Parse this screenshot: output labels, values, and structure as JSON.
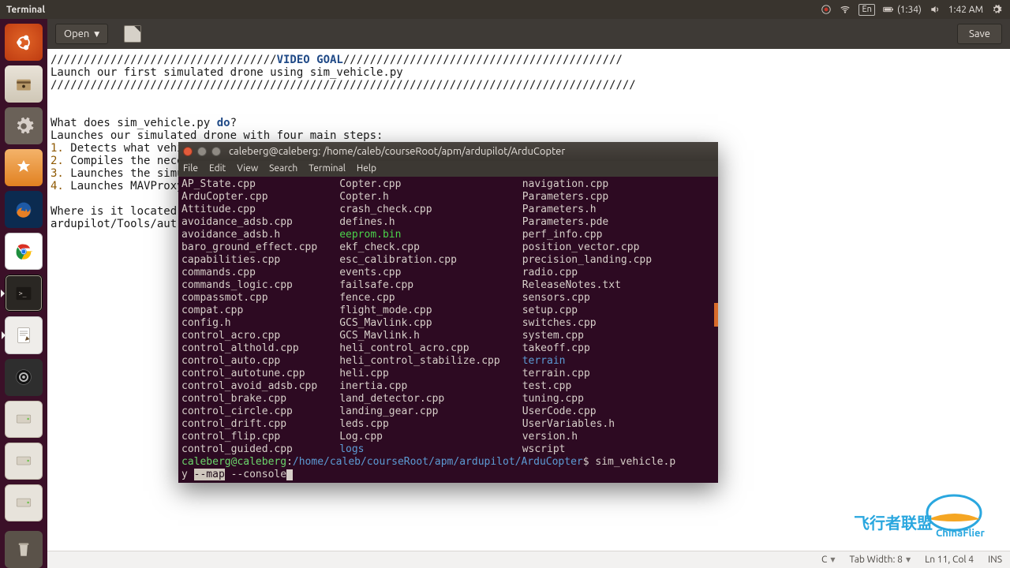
{
  "top_panel": {
    "app_title": "Terminal",
    "language": "En",
    "battery_text": "(1:34)",
    "clock": "1:42 AM"
  },
  "gedit": {
    "open_label": "Open",
    "save_label": "Save",
    "comment_border_a": "//////////////////////////////////",
    "heading": "VIDEO GOAL",
    "comment_border_b": "//////////////////////////////////////////",
    "intro_line": "Launch our first simulated drone using sim_vehicle.py",
    "comment_border_full": "////////////////////////////////////////////////////////////////////////////////////////",
    "question": "What does sim_vehicle.py",
    "question_kw": "do",
    "question_tail": "?",
    "desc": "Launches our simulated drone with four main steps:",
    "steps": [
      "Detects what vehi",
      "Compiles the nece",
      "Launches the simu",
      "Launches MAVProxy"
    ],
    "where_q": "Where is it located",
    "where_a": "ardupilot/Tools/aut"
  },
  "status_bar": {
    "lang": "C",
    "tab_width": "Tab Width: 8",
    "cursor": "Ln 11, Col 4",
    "insert": "INS"
  },
  "terminal": {
    "title": "caleberg@caleberg: /home/caleb/courseRoot/apm/ardupilot/ArduCopter",
    "menu": [
      "File",
      "Edit",
      "View",
      "Search",
      "Terminal",
      "Help"
    ],
    "files_col1": [
      "AP_State.cpp",
      "ArduCopter.cpp",
      "Attitude.cpp",
      "avoidance_adsb.cpp",
      "avoidance_adsb.h",
      "baro_ground_effect.cpp",
      "capabilities.cpp",
      "commands.cpp",
      "commands_logic.cpp",
      "compassmot.cpp",
      "compat.cpp",
      "config.h",
      "control_acro.cpp",
      "control_althold.cpp",
      "control_auto.cpp",
      "control_autotune.cpp",
      "control_avoid_adsb.cpp",
      "control_brake.cpp",
      "control_circle.cpp",
      "control_drift.cpp",
      "control_flip.cpp",
      "control_guided.cpp"
    ],
    "files_col2": [
      "Copter.cpp",
      "Copter.h",
      "crash_check.cpp",
      "defines.h",
      {
        "name": "eeprom.bin",
        "color": "green"
      },
      "ekf_check.cpp",
      "esc_calibration.cpp",
      "events.cpp",
      "failsafe.cpp",
      "fence.cpp",
      "flight_mode.cpp",
      "GCS_Mavlink.cpp",
      "GCS_Mavlink.h",
      "heli_control_acro.cpp",
      "heli_control_stabilize.cpp",
      "heli.cpp",
      "inertia.cpp",
      "land_detector.cpp",
      "landing_gear.cpp",
      "leds.cpp",
      "Log.cpp",
      {
        "name": "logs",
        "color": "blue"
      }
    ],
    "files_col3": [
      "navigation.cpp",
      "Parameters.cpp",
      "Parameters.h",
      "Parameters.pde",
      "perf_info.cpp",
      "position_vector.cpp",
      "precision_landing.cpp",
      "radio.cpp",
      "ReleaseNotes.txt",
      "sensors.cpp",
      "setup.cpp",
      "switches.cpp",
      "system.cpp",
      "takeoff.cpp",
      {
        "name": "terrain",
        "color": "blue"
      },
      "terrain.cpp",
      "test.cpp",
      "tuning.cpp",
      "UserCode.cpp",
      "UserVariables.h",
      "version.h",
      "wscript"
    ],
    "prompt_user": "caleberg@caleberg",
    "prompt_sep": ":",
    "prompt_path": "/home/caleb/courseRoot/apm/ardupilot/ArduCopter",
    "prompt_sym": "$ ",
    "cmd_part1": "sim_vehicle.p",
    "cmd_part2_prefix": "y ",
    "cmd_sel": "--map",
    "cmd_part3": " --console"
  },
  "watermark": {
    "cn": "飞行者联盟",
    "en": "ChinaFlier"
  }
}
